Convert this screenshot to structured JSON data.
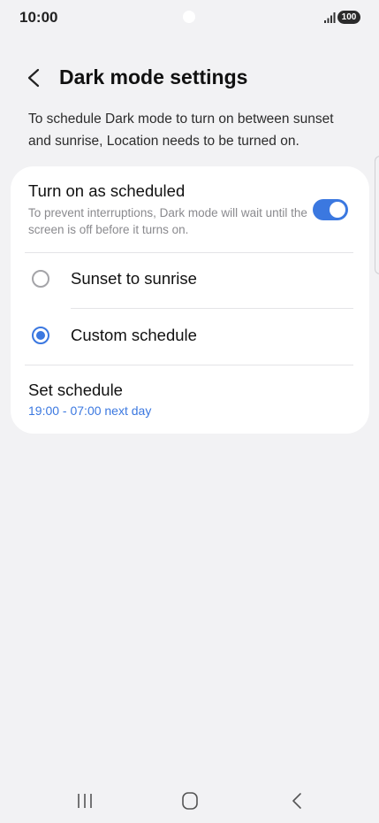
{
  "status_bar": {
    "time": "10:00",
    "battery": "100",
    "signal_icon": "signal-bars-icon"
  },
  "header": {
    "title": "Dark mode settings",
    "back_icon": "chevron-left-icon"
  },
  "description": "To schedule Dark mode to turn on between sunset and sunrise, Location needs to be turned on.",
  "card": {
    "scheduled": {
      "title": "Turn on as scheduled",
      "subtitle": "To prevent interruptions, Dark mode will wait until the screen is off before it turns on.",
      "enabled": true
    },
    "options": [
      {
        "label": "Sunset to sunrise",
        "selected": false
      },
      {
        "label": "Custom schedule",
        "selected": true
      }
    ],
    "set_schedule": {
      "title": "Set schedule",
      "value": "19:00 - 07:00 next day"
    }
  },
  "nav_bar": {
    "recents_icon": "recents-icon",
    "home_icon": "home-icon",
    "back_icon": "back-icon"
  },
  "colors": {
    "accent": "#3b78e0",
    "background": "#f2f2f4",
    "card": "#ffffff"
  }
}
